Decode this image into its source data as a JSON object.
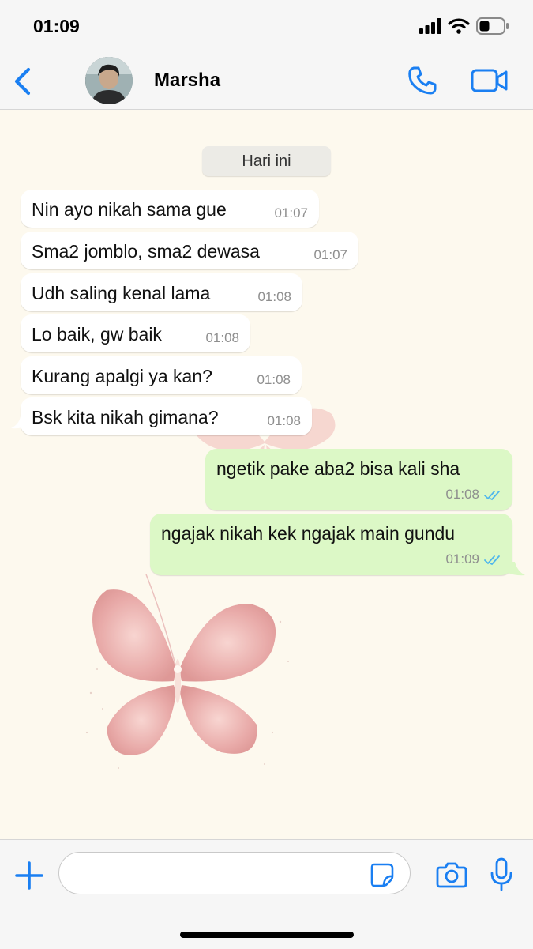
{
  "status_bar": {
    "time": "01:09"
  },
  "header": {
    "contact_name": "Marsha",
    "icons": [
      "chevron-left-icon",
      "phone-icon",
      "video-camera-icon"
    ]
  },
  "chat": {
    "date_label": "Hari ini",
    "incoming": [
      {
        "text": "Nin ayo nikah sama gue",
        "time": "01:07"
      },
      {
        "text": "Sma2 jomblo, sma2 dewasa",
        "time": "01:07"
      },
      {
        "text": "Udh saling kenal lama",
        "time": "01:08"
      },
      {
        "text": "Lo baik, gw baik",
        "time": "01:08"
      },
      {
        "text": "Kurang apalgi ya kan?",
        "time": "01:08"
      },
      {
        "text": "Bsk kita nikah gimana?",
        "time": "01:08"
      }
    ],
    "outgoing": [
      {
        "text": "ngetik pake aba2 bisa kali sha",
        "time": "01:08",
        "status": "read"
      },
      {
        "text": "ngajak nikah kek ngajak main gundu",
        "time": "01:09",
        "status": "read"
      }
    ]
  },
  "composer": {
    "input_value": "",
    "icons": [
      "plus-icon",
      "sticker-icon",
      "camera-icon",
      "microphone-icon"
    ]
  },
  "colors": {
    "accent": "#1a7ff2",
    "incoming_bubble": "#ffffff",
    "outgoing_bubble": "#dcf8c6",
    "read_ticks": "#4fb6ec",
    "chat_background": "#fdf9ee"
  }
}
